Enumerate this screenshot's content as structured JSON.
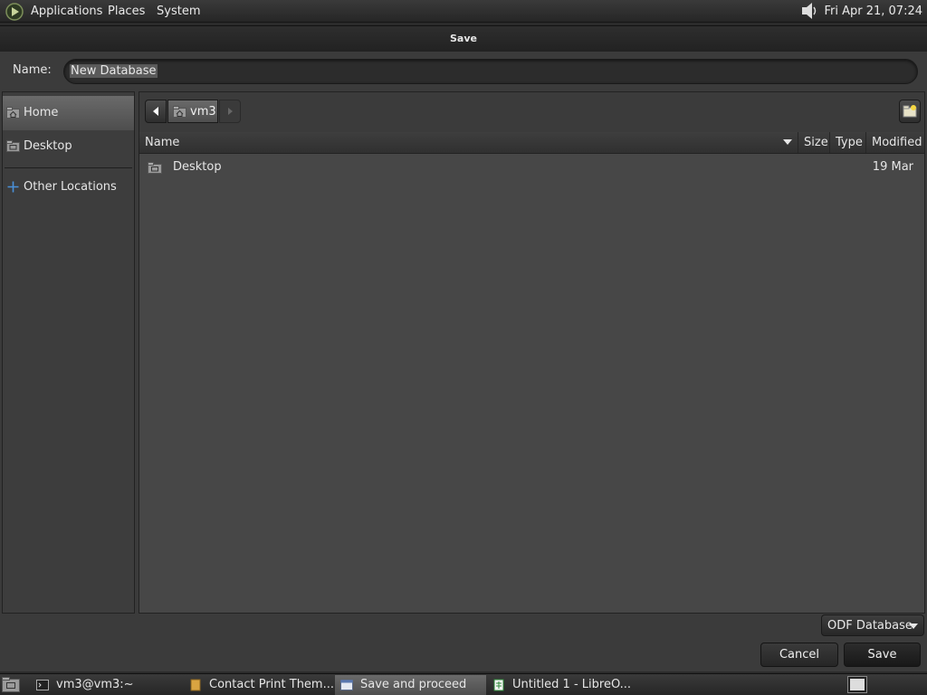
{
  "top_panel": {
    "menus": [
      "Applications",
      "Places",
      "System"
    ],
    "clock": "Fri Apr 21, 07:24",
    "icons": [
      "app-logo-icon",
      "volume-icon"
    ]
  },
  "dialog": {
    "title": "Save",
    "name_label": "Name:",
    "name_value": "New Database",
    "sidebar": {
      "items": [
        {
          "label": "Home",
          "icon": "home-folder-icon",
          "selected": true
        },
        {
          "label": "Desktop",
          "icon": "desktop-folder-icon",
          "selected": false
        },
        {
          "label": "Other Locations",
          "icon": "plus-icon",
          "selected": false
        }
      ]
    },
    "path_bar": {
      "current": "vm3"
    },
    "columns": {
      "name": "Name",
      "size": "Size",
      "type": "Type",
      "modified": "Modified"
    },
    "files": [
      {
        "name": "Desktop",
        "modified": "19 Mar",
        "icon": "folder-icon"
      }
    ],
    "file_type_filter": "ODF Database",
    "buttons": {
      "cancel": "Cancel",
      "save": "Save"
    }
  },
  "taskbar": {
    "tasks": [
      {
        "label": "vm3@vm3:~",
        "icon": "terminal-icon"
      },
      {
        "label": "Contact Print Them...",
        "icon": "document-icon"
      },
      {
        "label": "Save and proceed",
        "icon": "window-icon",
        "active": true
      },
      {
        "label": "Untitled 1 - LibreO...",
        "icon": "spreadsheet-icon"
      }
    ]
  },
  "colors": {
    "dialog_bg": "#3b3b3b",
    "list_bg": "#474747",
    "selection": "#5e5e5e",
    "accent_plus": "#4a90d9"
  }
}
